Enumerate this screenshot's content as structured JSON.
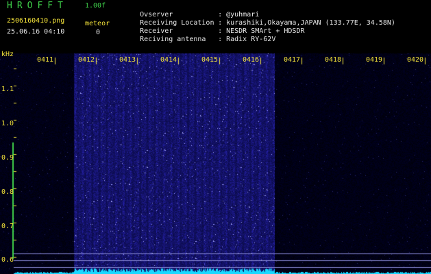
{
  "header": {
    "app_title": "HROFFT",
    "app_version": "1.00f",
    "file_name": "2506160410.png",
    "file_time": "25.06.16 04:10",
    "meteor_label": "meteor",
    "meteor_count": "0"
  },
  "info": [
    {
      "key": "Ovserver",
      "value": "@yuhmari"
    },
    {
      "key": "Receiving Location",
      "value": "kurashiki,Okayama,JAPAN (133.77E, 34.58N)"
    },
    {
      "key": "Receiver",
      "value": "NESDR SMArt + HDSDR"
    },
    {
      "key": "Reciving antenna",
      "value": "Radix RY-62V"
    }
  ],
  "chart_data": {
    "type": "heatmap",
    "ylabel": "kHz",
    "y_ticks": [
      "1.1",
      "1.0",
      "0.9",
      "0.8",
      "0.7",
      "0.6"
    ],
    "x_ticks": [
      "0411",
      "0412",
      "0413",
      "0414",
      "0415",
      "0416",
      "0417",
      "0418",
      "0419",
      "0420"
    ],
    "active_band_minutes": [
      "0412",
      "0416"
    ],
    "colors": {
      "background": "#000000",
      "signal": "#2a2ae0",
      "baseline": "#18d8ff",
      "axis": "#f3e23a",
      "title": "#3fd04a"
    }
  }
}
